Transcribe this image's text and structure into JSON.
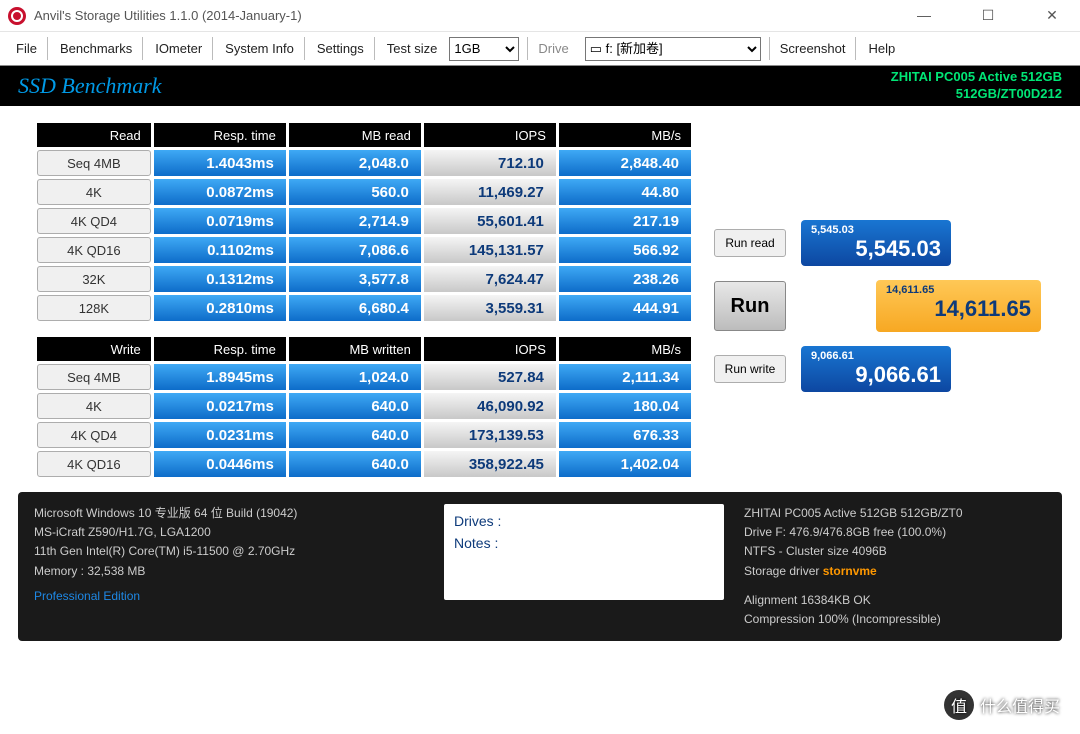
{
  "title": "Anvil's Storage Utilities 1.1.0 (2014-January-1)",
  "menu": [
    "File",
    "Benchmarks",
    "IOmeter",
    "System Info",
    "Settings",
    "Test size"
  ],
  "menu2": [
    "Screenshot",
    "Help"
  ],
  "drive_label": "Drive",
  "test_size_value": "1GB",
  "drive_value": "▭ f: [新加卷]",
  "banner_title": "SSD Benchmark",
  "device_line1": "ZHITAI PC005 Active 512GB",
  "device_line2": "512GB/ZT00D212",
  "read_headers": [
    "Read",
    "Resp. time",
    "MB read",
    "IOPS",
    "MB/s"
  ],
  "write_headers": [
    "Write",
    "Resp. time",
    "MB written",
    "IOPS",
    "MB/s"
  ],
  "read_rows": [
    {
      "label": "Seq 4MB",
      "rt": "1.4043ms",
      "mb": "2,048.0",
      "iops": "712.10",
      "mbs": "2,848.40"
    },
    {
      "label": "4K",
      "rt": "0.0872ms",
      "mb": "560.0",
      "iops": "11,469.27",
      "mbs": "44.80"
    },
    {
      "label": "4K QD4",
      "rt": "0.0719ms",
      "mb": "2,714.9",
      "iops": "55,601.41",
      "mbs": "217.19"
    },
    {
      "label": "4K QD16",
      "rt": "0.1102ms",
      "mb": "7,086.6",
      "iops": "145,131.57",
      "mbs": "566.92"
    },
    {
      "label": "32K",
      "rt": "0.1312ms",
      "mb": "3,577.8",
      "iops": "7,624.47",
      "mbs": "238.26"
    },
    {
      "label": "128K",
      "rt": "0.2810ms",
      "mb": "6,680.4",
      "iops": "3,559.31",
      "mbs": "444.91"
    }
  ],
  "write_rows": [
    {
      "label": "Seq 4MB",
      "rt": "1.8945ms",
      "mb": "1,024.0",
      "iops": "527.84",
      "mbs": "2,111.34"
    },
    {
      "label": "4K",
      "rt": "0.0217ms",
      "mb": "640.0",
      "iops": "46,090.92",
      "mbs": "180.04"
    },
    {
      "label": "4K QD4",
      "rt": "0.0231ms",
      "mb": "640.0",
      "iops": "173,139.53",
      "mbs": "676.33"
    },
    {
      "label": "4K QD16",
      "rt": "0.0446ms",
      "mb": "640.0",
      "iops": "358,922.45",
      "mbs": "1,402.04"
    }
  ],
  "run_read_label": "Run read",
  "run_label": "Run",
  "run_write_label": "Run write",
  "score_read": {
    "small": "5,545.03",
    "big": "5,545.03"
  },
  "score_total": {
    "small": "14,611.65",
    "big": "14,611.65"
  },
  "score_write": {
    "small": "9,066.61",
    "big": "9,066.61"
  },
  "sys": {
    "l1": "Microsoft Windows 10 专业版 64 位 Build (19042)",
    "l2": "MS-iCraft Z590/H1.7G, LGA1200",
    "l3": "11th Gen Intel(R) Core(TM) i5-11500 @ 2.70GHz",
    "l4": "Memory : 32,538 MB",
    "edition": "Professional Edition"
  },
  "notes": {
    "drives": "Drives :",
    "notes": "Notes :"
  },
  "drive": {
    "l1": "ZHITAI PC005 Active 512GB 512GB/ZT0",
    "l2": "Drive F: 476.9/476.8GB free (100.0%)",
    "l3": "NTFS - Cluster size 4096B",
    "l4": "Storage driver ",
    "storn": "stornvme",
    "l5": "Alignment 16384KB OK",
    "l6": "Compression 100% (Incompressible)"
  },
  "watermark": "什么值得买",
  "wm_char": "值"
}
